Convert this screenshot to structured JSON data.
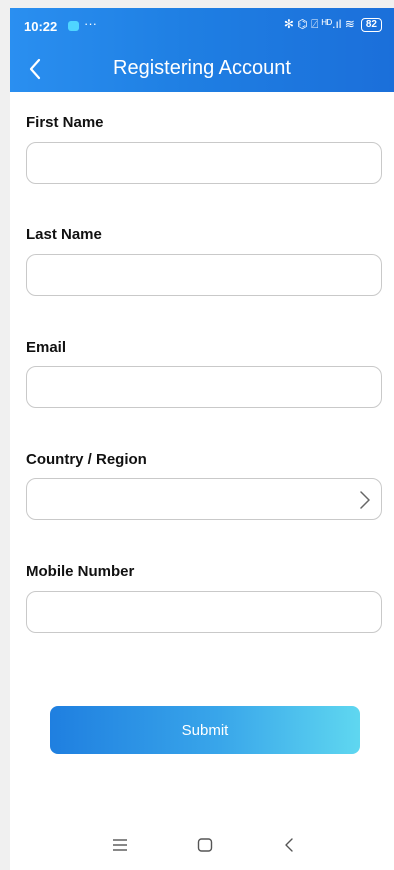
{
  "status_bar": {
    "time": "10:22",
    "dots": "···",
    "icons_text": "✻ ⌬ ⍁ ᴴᴰ.ıl ≋",
    "battery": "82"
  },
  "header": {
    "title": "Registering Account",
    "back_icon": "chevron-left-icon"
  },
  "form": {
    "first_name": {
      "label": "First Name",
      "value": "",
      "placeholder": ""
    },
    "last_name": {
      "label": "Last Name",
      "value": "",
      "placeholder": ""
    },
    "email": {
      "label": "Email",
      "value": "",
      "placeholder": ""
    },
    "country": {
      "label": "Country / Region",
      "value": "",
      "placeholder": ""
    },
    "mobile": {
      "label": "Mobile Number",
      "value": "",
      "placeholder": ""
    },
    "submit_label": "Submit"
  },
  "nav": {
    "menu_icon": "menu-icon",
    "home_icon": "home-square-icon",
    "back_icon": "back-chevron-icon"
  },
  "colors": {
    "brand_blue": "#1f7fe3",
    "submit_end": "#5fd7f0",
    "border": "#c9c9c9"
  }
}
